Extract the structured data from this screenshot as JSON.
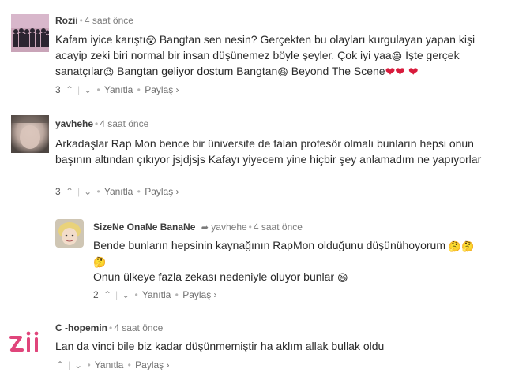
{
  "comments": [
    {
      "author": "Rozii",
      "time": "4 saat önce",
      "text_1": "Kafam iyice karıştı",
      "text_2": " Bangtan sen nesin? Gerçekten bu olaylarıkurgulayan yapan kişi acayip zeki biri normal bir insan düşünemez böyle şeyler. Çok iyi yaa",
      "text_3": " İşte gerçek sanatçılar",
      "text_4": " Bangtan geliyor dostum Bangtan",
      "text_5": " Beyond The Scene",
      "emoji_1": "😵",
      "emoji_2": "😄",
      "emoji_3": "😉",
      "emoji_4": "😆",
      "hearts": "❤❤ ❤",
      "count": "3",
      "reply": "Yanıtla",
      "share": "Paylaş ›"
    },
    {
      "author": "yavhehe",
      "time": "4 saat önce",
      "text": "Arkadaşlar Rap Mon bence bir üniversite de falan profesör olmalı bunların hepsi onun başının altından çıkıyor jsjdjsjs Kafayı yiyecem yine hiçbir şey anlamadım ne yapıyorlar",
      "count": "3",
      "reply": "Yanıtla",
      "share": "Paylaş ›"
    },
    {
      "author": "SizeNe OnaNe BanaNe",
      "reply_to": "yavhehe",
      "time": "4 saat önce",
      "line_1": "Bende bunların hepsinin kaynağının RapMon olduğunu düşünühoyorum",
      "line_2": "Onun ülkeye fazla zekası nedeniyle oluyor bunlar",
      "emoji_1": "🤔",
      "emoji_2": "😆",
      "count": "2",
      "reply": "Yanıtla",
      "share": "Paylaş ›"
    },
    {
      "author": "C -hopemin",
      "time": "4 saat önce",
      "text": "Lan da vinci bile biz kadar düşünmemiştir ha aklım allak bullak oldu",
      "reply": "Yanıtla",
      "share": "Paylaş ›"
    }
  ],
  "colors": {
    "heart": "#d81b3c",
    "avatar_logo": "#e0457b"
  },
  "icons": {
    "upvote": "^",
    "downvote": "v",
    "reply_arrow": "➦",
    "dot": "•",
    "separator": "|"
  }
}
